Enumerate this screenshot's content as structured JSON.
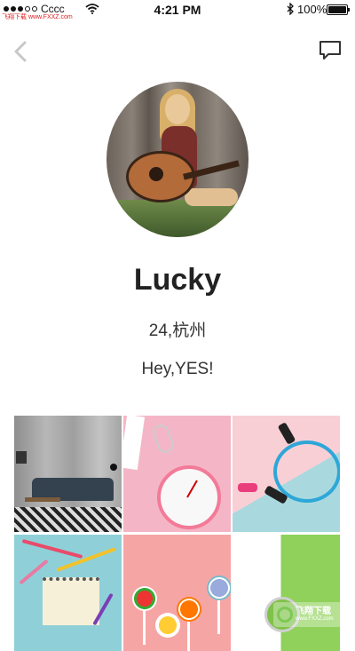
{
  "status_bar": {
    "carrier": "Cccc",
    "time": "4:21 PM",
    "battery_percent": "100%",
    "watermark_top": "飞翔下载 www.FXXZ.com"
  },
  "nav": {
    "back_icon": "chevron-left-icon",
    "message_icon": "chat-bubble-icon"
  },
  "profile": {
    "name": "Lucky",
    "age_city": "24,杭州",
    "bio": "Hey,YES!"
  },
  "photos": [
    {
      "name": "photo-living-room"
    },
    {
      "name": "photo-clock"
    },
    {
      "name": "photo-jump-rope"
    },
    {
      "name": "photo-notebook"
    },
    {
      "name": "photo-lollipops"
    },
    {
      "name": "photo-green"
    }
  ],
  "watermark": {
    "title": "飞翔下载",
    "site": "www.FXXZ.com"
  },
  "colors": {
    "accent_text": "#222222",
    "background": "#ffffff"
  }
}
